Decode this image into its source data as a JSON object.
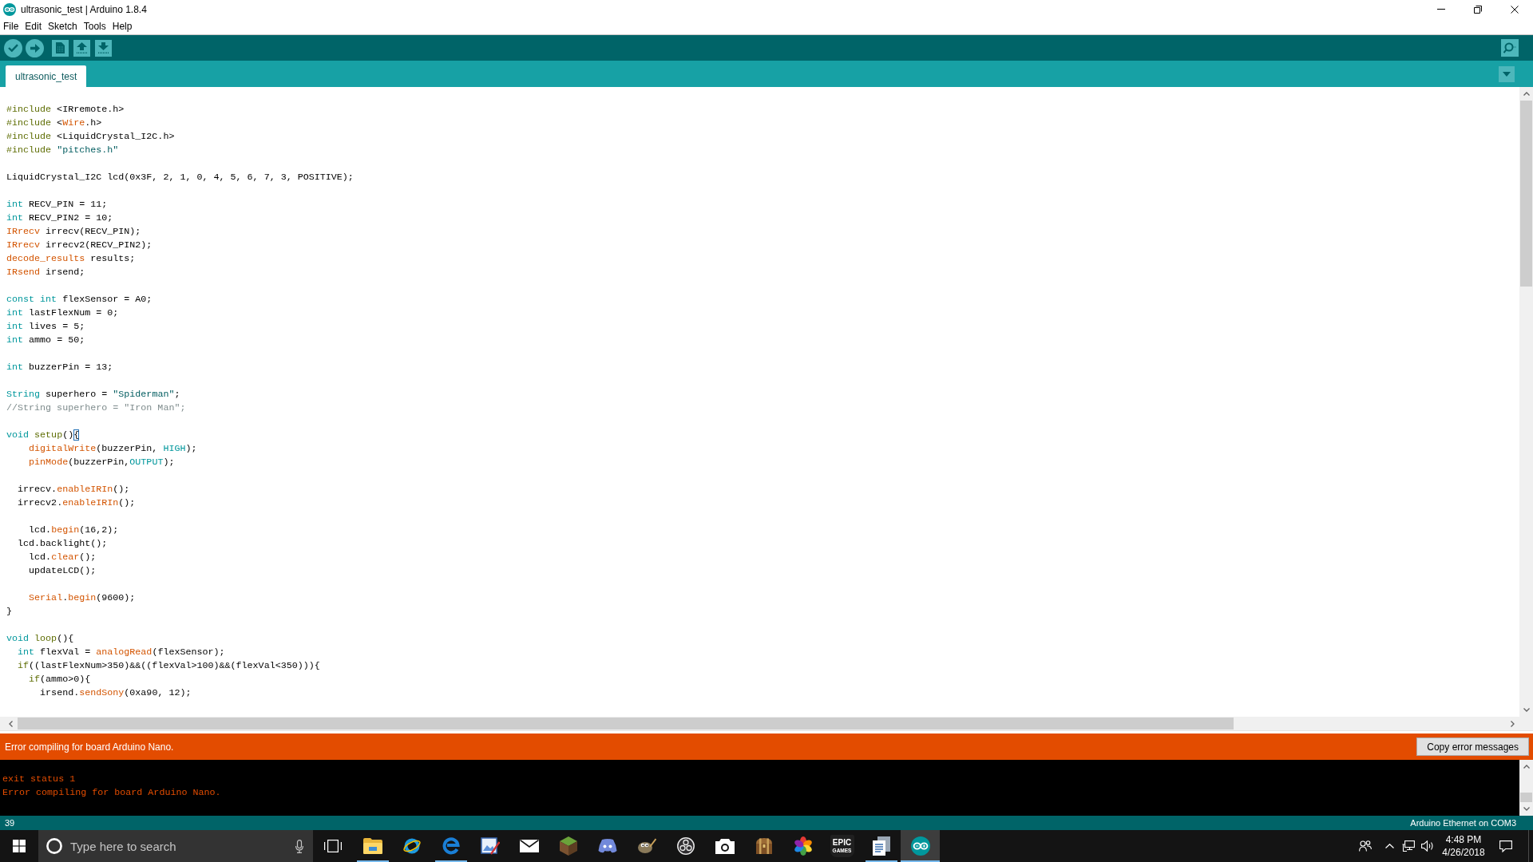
{
  "window": {
    "title": "ultrasonic_test | Arduino 1.8.4"
  },
  "menu": [
    "File",
    "Edit",
    "Sketch",
    "Tools",
    "Help"
  ],
  "sketch_tabs": [
    {
      "label": "ultrasonic_test",
      "selected": true
    }
  ],
  "editor": {
    "blocks": [
      {
        "lines": [
          {
            "tokens": [
              {
                "kind": "structure",
                "text": "#include"
              },
              {
                "kind": "plain",
                "text": " <IRremote.h>"
              }
            ]
          },
          {
            "tokens": [
              {
                "kind": "structure",
                "text": "#include"
              },
              {
                "kind": "plain",
                "text": " <"
              },
              {
                "kind": "function",
                "text": "Wire"
              },
              {
                "kind": "plain",
                "text": ".h>"
              }
            ]
          },
          {
            "tokens": [
              {
                "kind": "structure",
                "text": "#include"
              },
              {
                "kind": "plain",
                "text": " <LiquidCrystal_I2C.h>"
              }
            ]
          },
          {
            "tokens": [
              {
                "kind": "structure",
                "text": "#include "
              },
              {
                "kind": "string",
                "text": "\"pitches.h\""
              }
            ]
          }
        ]
      },
      {
        "lines": [
          {
            "tokens": [
              {
                "kind": "plain",
                "text": "LiquidCrystal_I2C lcd(0x3F, 2, 1, 0, 4, 5, 6, 7, 3, POSITIVE);"
              }
            ]
          }
        ]
      },
      {
        "lines": [
          {
            "tokens": [
              {
                "kind": "keyword",
                "text": "int"
              },
              {
                "kind": "plain",
                "text": " RECV_PIN = 11;"
              }
            ]
          },
          {
            "tokens": [
              {
                "kind": "keyword",
                "text": "int"
              },
              {
                "kind": "plain",
                "text": " RECV_PIN2 = 10;"
              }
            ]
          },
          {
            "tokens": [
              {
                "kind": "function",
                "text": "IRrecv"
              },
              {
                "kind": "plain",
                "text": " irrecv(RECV_PIN);"
              }
            ]
          },
          {
            "tokens": [
              {
                "kind": "function",
                "text": "IRrecv"
              },
              {
                "kind": "plain",
                "text": " irrecv2(RECV_PIN2);"
              }
            ]
          },
          {
            "tokens": [
              {
                "kind": "function",
                "text": "decode_results"
              },
              {
                "kind": "plain",
                "text": " results;"
              }
            ]
          },
          {
            "tokens": [
              {
                "kind": "function",
                "text": "IRsend"
              },
              {
                "kind": "plain",
                "text": " irsend;"
              }
            ]
          }
        ]
      },
      {
        "lines": [
          {
            "tokens": [
              {
                "kind": "keyword",
                "text": "const int"
              },
              {
                "kind": "plain",
                "text": " flexSensor = A0;"
              }
            ]
          },
          {
            "tokens": [
              {
                "kind": "keyword",
                "text": "int"
              },
              {
                "kind": "plain",
                "text": " lastFlexNum = 0;"
              }
            ]
          },
          {
            "tokens": [
              {
                "kind": "keyword",
                "text": "int"
              },
              {
                "kind": "plain",
                "text": " lives = 5;"
              }
            ]
          },
          {
            "tokens": [
              {
                "kind": "keyword",
                "text": "int"
              },
              {
                "kind": "plain",
                "text": " ammo = 50;"
              }
            ]
          }
        ]
      },
      {
        "lines": [
          {
            "tokens": [
              {
                "kind": "keyword",
                "text": "int"
              },
              {
                "kind": "plain",
                "text": " buzzerPin = 13;"
              }
            ]
          }
        ]
      },
      {
        "lines": [
          {
            "tokens": [
              {
                "kind": "keyword",
                "text": "String"
              },
              {
                "kind": "plain",
                "text": " superhero = "
              },
              {
                "kind": "string",
                "text": "\"Spiderman\""
              },
              {
                "kind": "plain",
                "text": ";"
              }
            ]
          },
          {
            "tokens": [
              {
                "kind": "comment",
                "text": "//String superhero = \"Iron Man\";"
              }
            ]
          }
        ]
      },
      {
        "lines": [
          {
            "tokens": [
              {
                "kind": "keyword",
                "text": "void "
              },
              {
                "kind": "structure",
                "text": "setup"
              },
              {
                "kind": "plain",
                "text": "()"
              },
              {
                "kind": "bracket",
                "text": "{"
              }
            ]
          },
          {
            "tokens": [
              {
                "kind": "function",
                "text": "    digitalWrite"
              },
              {
                "kind": "plain",
                "text": "(buzzerPin, "
              },
              {
                "kind": "keyword",
                "text": "HIGH"
              },
              {
                "kind": "plain",
                "text": ");"
              }
            ]
          },
          {
            "tokens": [
              {
                "kind": "function",
                "text": "    pinMode"
              },
              {
                "kind": "plain",
                "text": "(buzzerPin,"
              },
              {
                "kind": "keyword",
                "text": "OUTPUT"
              },
              {
                "kind": "plain",
                "text": ");"
              }
            ]
          }
        ]
      },
      {
        "lines": [
          {
            "tokens": [
              {
                "kind": "plain",
                "text": "  irrecv."
              },
              {
                "kind": "function",
                "text": "enableIRIn"
              },
              {
                "kind": "plain",
                "text": "();"
              }
            ]
          },
          {
            "tokens": [
              {
                "kind": "plain",
                "text": "  irrecv2."
              },
              {
                "kind": "function",
                "text": "enableIRIn"
              },
              {
                "kind": "plain",
                "text": "();"
              }
            ]
          }
        ]
      },
      {
        "lines": [
          {
            "tokens": [
              {
                "kind": "plain",
                "text": "    lcd."
              },
              {
                "kind": "function",
                "text": "begin"
              },
              {
                "kind": "plain",
                "text": "(16,2);"
              }
            ]
          },
          {
            "tokens": [
              {
                "kind": "plain",
                "text": "  lcd.backlight();"
              }
            ]
          },
          {
            "tokens": [
              {
                "kind": "plain",
                "text": "    lcd."
              },
              {
                "kind": "function",
                "text": "clear"
              },
              {
                "kind": "plain",
                "text": "();"
              }
            ]
          },
          {
            "tokens": [
              {
                "kind": "plain",
                "text": "    updateLCD();"
              }
            ]
          }
        ]
      },
      {
        "lines": [
          {
            "tokens": [
              {
                "kind": "function",
                "text": "    Serial"
              },
              {
                "kind": "plain",
                "text": "."
              },
              {
                "kind": "function",
                "text": "begin"
              },
              {
                "kind": "plain",
                "text": "(9600);"
              }
            ]
          },
          {
            "tokens": [
              {
                "kind": "plain",
                "text": "}"
              }
            ]
          }
        ]
      },
      {
        "lines": [
          {
            "tokens": [
              {
                "kind": "keyword",
                "text": "void "
              },
              {
                "kind": "structure",
                "text": "loop"
              },
              {
                "kind": "plain",
                "text": "(){"
              }
            ]
          },
          {
            "tokens": [
              {
                "kind": "keyword",
                "text": "  int"
              },
              {
                "kind": "plain",
                "text": " flexVal = "
              },
              {
                "kind": "function",
                "text": "analogRead"
              },
              {
                "kind": "plain",
                "text": "(flexSensor);"
              }
            ]
          },
          {
            "tokens": [
              {
                "kind": "structure",
                "text": "  if"
              },
              {
                "kind": "plain",
                "text": "((lastFlexNum>350)&&((flexVal>100)&&(flexVal<350))){"
              }
            ]
          },
          {
            "tokens": [
              {
                "kind": "structure",
                "text": "    if"
              },
              {
                "kind": "plain",
                "text": "(ammo>0){"
              }
            ]
          },
          {
            "tokens": [
              {
                "kind": "plain",
                "text": "      irsend."
              },
              {
                "kind": "function",
                "text": "sendSony"
              },
              {
                "kind": "plain",
                "text": "(0xa90, 12);"
              }
            ]
          }
        ]
      }
    ]
  },
  "console": {
    "message": "Error compiling for board Arduino Nano.",
    "copy_button": "Copy error messages",
    "output": [
      "exit status 1",
      "Error compiling for board Arduino Nano."
    ]
  },
  "status_bar": {
    "line": "39",
    "board": "Arduino Ethernet on COM3"
  },
  "taskbar": {
    "search": {
      "placeholder": "Type here to search"
    },
    "apps": [
      {
        "kind": "folder",
        "running": true,
        "selected": false
      },
      {
        "kind": "orbit",
        "running": false,
        "selected": false
      },
      {
        "kind": "arc",
        "running": true,
        "selected": false
      },
      {
        "kind": "picture",
        "running": false,
        "selected": false
      },
      {
        "kind": "envelope",
        "running": false,
        "selected": false
      },
      {
        "kind": "cube",
        "running": false,
        "selected": false
      },
      {
        "kind": "gamepad",
        "running": false,
        "selected": false
      },
      {
        "kind": "creature",
        "running": false,
        "selected": false
      },
      {
        "kind": "rings",
        "running": false,
        "selected": false
      },
      {
        "kind": "camera",
        "running": false,
        "selected": false
      },
      {
        "kind": "chest",
        "running": false,
        "selected": false
      },
      {
        "kind": "pinwheel",
        "running": false,
        "selected": false
      },
      {
        "kind": "badge",
        "logo_text": [
          "EPIC",
          "GAMES"
        ],
        "running": false,
        "selected": false
      },
      {
        "kind": "documents",
        "running": true,
        "selected": false
      },
      {
        "kind": "infinity",
        "running": true,
        "selected": true
      }
    ],
    "time": "4:48 PM",
    "date": "4/26/2018"
  }
}
